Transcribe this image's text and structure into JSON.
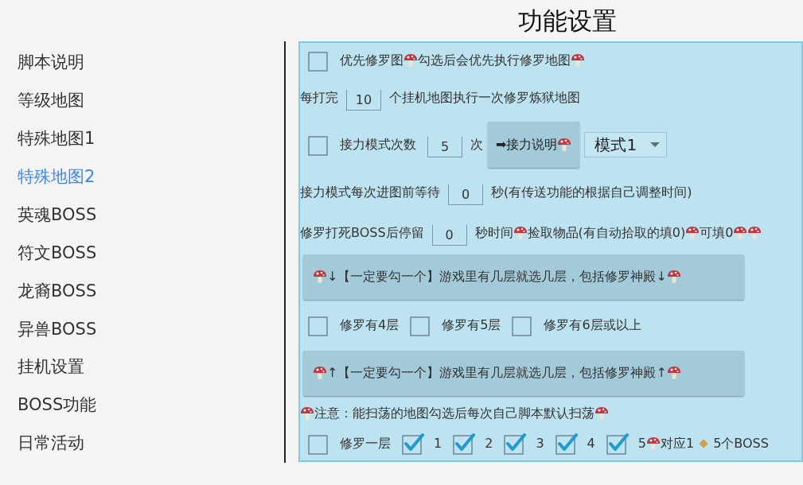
{
  "title": "功能设置",
  "sidebar": {
    "items": [
      {
        "label": "脚本说明",
        "selected": false
      },
      {
        "label": "等级地图",
        "selected": false
      },
      {
        "label": "特殊地图1",
        "selected": false
      },
      {
        "label": "特殊地图2",
        "selected": true
      },
      {
        "label": "英魂BOSS",
        "selected": false
      },
      {
        "label": "符文BOSS",
        "selected": false
      },
      {
        "label": "龙裔BOSS",
        "selected": false
      },
      {
        "label": "异兽BOSS",
        "selected": false
      },
      {
        "label": "挂机设置",
        "selected": false
      },
      {
        "label": "BOSS功能",
        "selected": false
      },
      {
        "label": "日常活动",
        "selected": false
      }
    ]
  },
  "panel": {
    "rows": [
      {
        "items": [
          {
            "kind": "checkbox",
            "checked": false,
            "label": [
              {
                "kind": "text",
                "text": "优先修罗图"
              },
              {
                "kind": "mark"
              },
              {
                "kind": "text",
                "text": "勾选后会优先执行修罗地图"
              },
              {
                "kind": "mark"
              }
            ]
          }
        ]
      },
      {
        "items": [
          {
            "kind": "text",
            "segments": [
              {
                "kind": "text",
                "text": "每打完"
              }
            ]
          },
          {
            "kind": "field",
            "value": "10"
          },
          {
            "kind": "text",
            "segments": [
              {
                "kind": "text",
                "text": "个挂机地图执行一次修罗炼狱地图"
              }
            ]
          }
        ]
      },
      {
        "items": [
          {
            "kind": "checkbox",
            "checked": false,
            "label": [
              {
                "kind": "text",
                "text": "接力模式次数"
              }
            ]
          },
          {
            "kind": "field",
            "value": "5"
          },
          {
            "kind": "text",
            "segments": [
              {
                "kind": "text",
                "text": "次"
              }
            ]
          },
          {
            "kind": "button",
            "segments": [
              {
                "kind": "text",
                "text": "➡接力说明"
              },
              {
                "kind": "mark"
              }
            ]
          },
          {
            "kind": "select",
            "value": "模式1"
          }
        ]
      },
      {
        "items": [
          {
            "kind": "text",
            "segments": [
              {
                "kind": "text",
                "text": "接力模式每次进图前等待"
              }
            ]
          },
          {
            "kind": "field",
            "value": "0"
          },
          {
            "kind": "text",
            "segments": [
              {
                "kind": "text",
                "text": "秒(有传送功能的根据自己调整时间)"
              }
            ]
          }
        ]
      },
      {
        "items": [
          {
            "kind": "text",
            "segments": [
              {
                "kind": "text",
                "text": "修罗打死BOSS后停留"
              }
            ]
          },
          {
            "kind": "field",
            "value": "0"
          },
          {
            "kind": "text",
            "segments": [
              {
                "kind": "text",
                "text": "秒时间"
              },
              {
                "kind": "mark"
              },
              {
                "kind": "text",
                "text": "捡取物品(有自动拾取的填0)"
              },
              {
                "kind": "mark"
              },
              {
                "kind": "text",
                "text": "可填0"
              },
              {
                "kind": "mark"
              },
              {
                "kind": "mark"
              }
            ]
          }
        ]
      },
      {
        "items": [
          {
            "kind": "banner",
            "segments": [
              {
                "kind": "mark"
              },
              {
                "kind": "text",
                "text": "↓【一定要勾一个】游戏里有几层就选几层，包括修罗神殿↓"
              },
              {
                "kind": "mark"
              }
            ]
          }
        ]
      },
      {
        "items": [
          {
            "kind": "checkbox",
            "checked": false,
            "label": [
              {
                "kind": "text",
                "text": "修罗有4层"
              }
            ]
          },
          {
            "kind": "checkbox",
            "checked": false,
            "label": [
              {
                "kind": "text",
                "text": "修罗有5层"
              }
            ]
          },
          {
            "kind": "checkbox",
            "checked": false,
            "label": [
              {
                "kind": "text",
                "text": "修罗有6层或以上"
              }
            ]
          }
        ]
      },
      {
        "items": [
          {
            "kind": "banner",
            "segments": [
              {
                "kind": "mark"
              },
              {
                "kind": "text",
                "text": "↑【一定要勾一个】游戏里有几层就选几层，包括修罗神殿↑"
              },
              {
                "kind": "mark"
              }
            ]
          }
        ]
      },
      {
        "items": [
          {
            "kind": "text",
            "segments": [
              {
                "kind": "mark"
              },
              {
                "kind": "text",
                "text": "注意：能扫荡的地图勾选后每次自己脚本默认扫荡"
              },
              {
                "kind": "mark"
              }
            ]
          }
        ]
      },
      {
        "items": [
          {
            "kind": "checkbox",
            "checked": false,
            "label": [
              {
                "kind": "text",
                "text": "修罗一层"
              }
            ]
          },
          {
            "kind": "checkbox",
            "checked": true,
            "label": [
              {
                "kind": "text",
                "text": "1"
              }
            ]
          },
          {
            "kind": "checkbox",
            "checked": true,
            "label": [
              {
                "kind": "text",
                "text": "2"
              }
            ]
          },
          {
            "kind": "checkbox",
            "checked": true,
            "label": [
              {
                "kind": "text",
                "text": "3"
              }
            ]
          },
          {
            "kind": "checkbox",
            "checked": true,
            "label": [
              {
                "kind": "text",
                "text": "4"
              }
            ]
          },
          {
            "kind": "checkbox",
            "checked": true,
            "label": [
              {
                "kind": "text",
                "text": "5"
              },
              {
                "kind": "mark"
              },
              {
                "kind": "text",
                "text": "对应1"
              },
              {
                "kind": "dot"
              },
              {
                "kind": "text",
                "text": "5个BOSS"
              }
            ]
          }
        ]
      }
    ]
  }
}
